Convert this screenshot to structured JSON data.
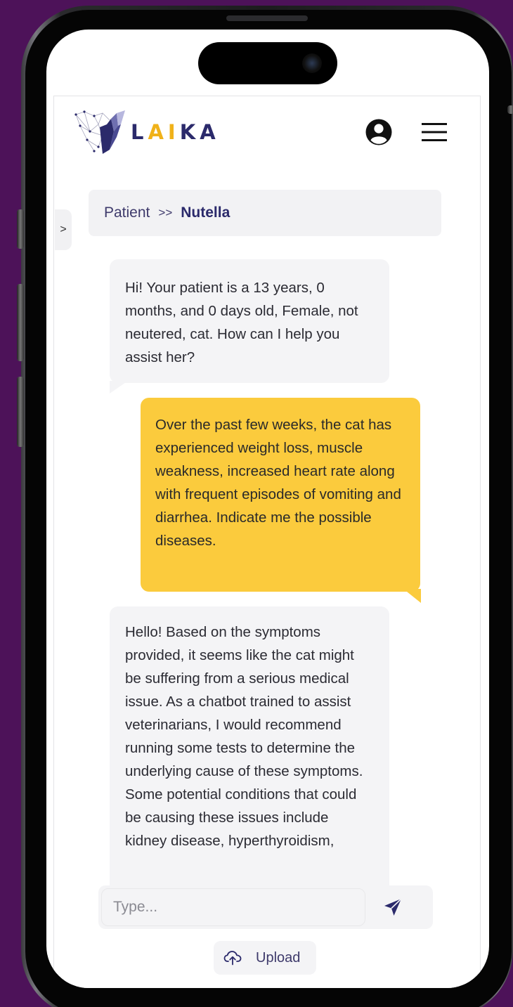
{
  "header": {
    "logo_text_l": "L",
    "logo_text_ai": "AI",
    "logo_text_ka": "KA",
    "user_icon": "user-circle-icon",
    "menu_icon": "hamburger-menu-icon"
  },
  "drawer": {
    "toggle_label": ">"
  },
  "breadcrumb": {
    "parent": "Patient",
    "separator": ">>",
    "current": "Nutella"
  },
  "messages": [
    {
      "role": "bot",
      "text": "Hi! Your patient is a 13 years, 0 months, and 0 days old, Female, not neutered, cat. How can I help you assist her?"
    },
    {
      "role": "user",
      "text": "Over the past few weeks, the cat has experienced weight loss, muscle weakness, increased heart rate along with frequent episodes of vomiting and diarrhea. Indicate me the possible diseases."
    },
    {
      "role": "bot",
      "text": "Hello! Based on the symptoms provided, it seems like the cat might be suffering from a serious medical issue. As a chatbot trained to assist veterinarians, I would recommend running some tests to determine the underlying cause of these symptoms. Some potential conditions that could be causing these issues include kidney disease, hyperthyroidism,"
    }
  ],
  "composer": {
    "placeholder": "Type...",
    "send_icon": "send-arrow-icon"
  },
  "upload": {
    "label": "Upload",
    "icon": "cloud-upload-icon"
  },
  "colors": {
    "background": "#4d1259",
    "brand_dark": "#2b2a6b",
    "brand_accent": "#f0b21a",
    "user_bubble": "#fbcb3d",
    "bot_bubble": "#f4f4f6"
  }
}
